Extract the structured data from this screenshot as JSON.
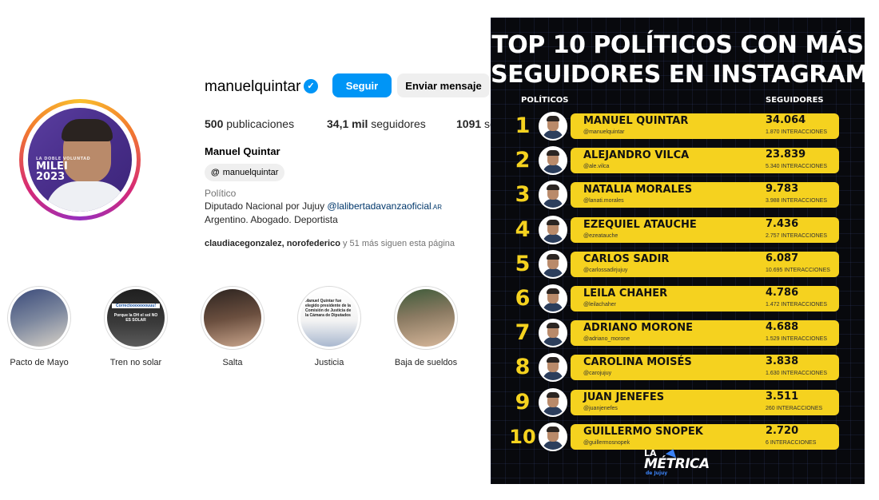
{
  "profile": {
    "username": "manuelquintar",
    "follow_label": "Seguir",
    "message_label": "Enviar mensaje",
    "avatar_text": [
      "LA DOBLE VOLUNTAD",
      "MILEI",
      "2023"
    ],
    "stats": {
      "posts_count": "500",
      "posts_label": "publicaciones",
      "followers_count": "34,1 mil",
      "followers_label": "seguidores",
      "following_count": "1091",
      "following_label": "se"
    },
    "full_name": "Manuel Quintar",
    "threads_handle": "manuelquintar",
    "category": "Político",
    "bio_line1_prefix": "Diputado Nacional por Jujuy ",
    "bio_link": "@lalibertadavanzaoficial",
    "bio_link_suffix": ".AR",
    "bio_line2": "Argentino. Abogado. Deportista",
    "followed_by": {
      "names": "claudiacegonzalez, norofederico",
      "rest": " y 51 más siguen esta página"
    },
    "highlights": [
      {
        "label": "Pacto de Mayo"
      },
      {
        "label": "Tren no solar",
        "mini1": "Correctooooooouuu!",
        "mini2": "Porque la DH el sol NO ES SOLAR"
      },
      {
        "label": "Salta"
      },
      {
        "label": "Justicia",
        "mini1": "Manuel Quintar fue elegido presidente de la Comisión de Justicia de la Cámara de Diputados"
      },
      {
        "label": "Baja de sueldos"
      }
    ]
  },
  "infographic": {
    "title_line1": "TOP 10 POLÍTICOS CON MÁS",
    "title_line2": "SEGUIDORES EN INSTAGRAM",
    "col_politicos": "POLÍTICOS",
    "col_seguidores": "SEGUIDORES",
    "colors": {
      "background": "#08090d",
      "accent": "#f5d21f",
      "text": "#111111"
    },
    "rows": [
      {
        "rank": "1",
        "name": "MANUEL QUINTAR",
        "handle": "@manuelquintar",
        "followers": "34.064",
        "interactions": "1.870 INTERACCIONES"
      },
      {
        "rank": "2",
        "name": "ALEJANDRO VILCA",
        "handle": "@ale.vilca",
        "followers": "23.839",
        "interactions": "5.340 INTERACCIONES"
      },
      {
        "rank": "3",
        "name": "NATALIA MORALES",
        "handle": "@lanati.morales",
        "followers": "9.783",
        "interactions": "3.988 INTERACCIONES"
      },
      {
        "rank": "4",
        "name": "EZEQUIEL ATAUCHE",
        "handle": "@ezeatauche",
        "followers": "7.436",
        "interactions": "2.757 INTERACCIONES"
      },
      {
        "rank": "5",
        "name": "CARLOS SADIR",
        "handle": "@carlossadirjujuy",
        "followers": "6.087",
        "interactions": "10.695 INTERACCIONES"
      },
      {
        "rank": "6",
        "name": "LEILA CHAHER",
        "handle": "@leilachaher",
        "followers": "4.786",
        "interactions": "1.472 INTERACCIONES"
      },
      {
        "rank": "7",
        "name": "ADRIANO MORONE",
        "handle": "@adriano_morone",
        "followers": "4.688",
        "interactions": "1.529 INTERACCIONES"
      },
      {
        "rank": "8",
        "name": "CAROLINA MOISÉS",
        "handle": "@carojujuy",
        "followers": "3.838",
        "interactions": "1.630 INTERACCIONES"
      },
      {
        "rank": "9",
        "name": "JUAN JENEFES",
        "handle": "@juanjenefes",
        "followers": "3.511",
        "interactions": "260 INTERACCIONES"
      },
      {
        "rank": "10",
        "name": "GUILLERMO SNOPEK",
        "handle": "@guillermosnopek",
        "followers": "2.720",
        "interactions": "6 INTERACCIONES"
      }
    ],
    "logo_line1": "LA",
    "logo_line2": "MÉTRICA",
    "logo_line3": "de Jujuy"
  }
}
